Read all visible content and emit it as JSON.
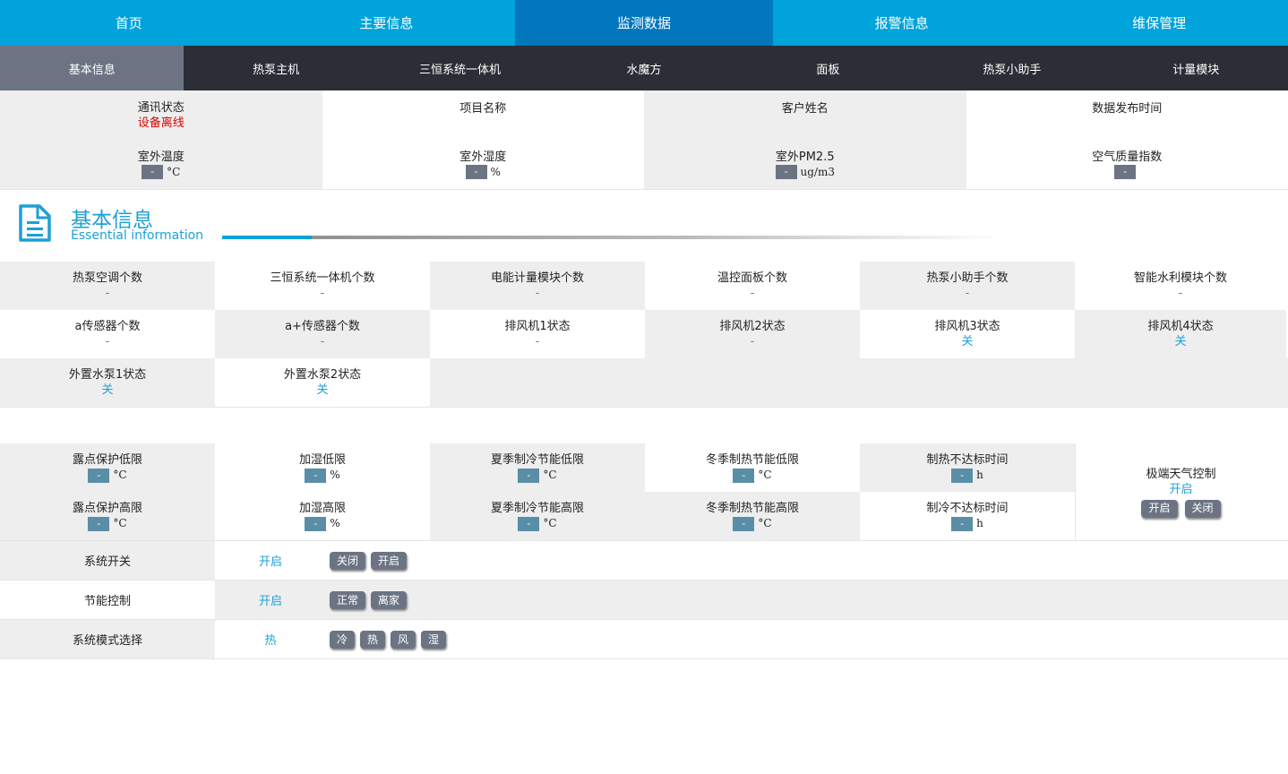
{
  "top_tabs": [
    "首页",
    "主要信息",
    "监测数据",
    "报警信息",
    "维保管理"
  ],
  "sub_tabs": [
    "基本信息",
    "热泵主机",
    "三恒系统一体机",
    "水魔方",
    "面板",
    "热泵小助手",
    "计量模块"
  ],
  "status": {
    "comm_label": "通讯状态",
    "comm_value": "设备离线",
    "project_label": "项目名称",
    "customer_label": "客户姓名",
    "publish_label": "数据发布时间"
  },
  "env": [
    {
      "label": "室外温度",
      "value": "-",
      "unit": "°C"
    },
    {
      "label": "室外湿度",
      "value": "-",
      "unit": "%"
    },
    {
      "label": "室外PM2.5",
      "value": "-",
      "unit": "ug/m3"
    },
    {
      "label": "空气质量指数",
      "value": "-",
      "unit": ""
    }
  ],
  "section": {
    "title": "基本信息",
    "subtitle": "Essential information"
  },
  "counts_row1": [
    {
      "label": "热泵空调个数",
      "value": "-"
    },
    {
      "label": "三恒系统一体机个数",
      "value": "-"
    },
    {
      "label": "电能计量模块个数",
      "value": "-"
    },
    {
      "label": "温控面板个数",
      "value": "-"
    },
    {
      "label": "热泵小助手个数",
      "value": "-"
    },
    {
      "label": "智能水利模块个数",
      "value": "-"
    }
  ],
  "counts_row2": [
    {
      "label": "a传感器个数",
      "value": "-"
    },
    {
      "label": "a+传感器个数",
      "value": "-"
    },
    {
      "label": "排风机1状态",
      "value": "-"
    },
    {
      "label": "排风机2状态",
      "value": "-"
    },
    {
      "label": "排风机3状态",
      "value": "关"
    },
    {
      "label": "排风机4状态",
      "value": "关"
    }
  ],
  "counts_row3": [
    {
      "label": "外置水泵1状态",
      "value": "关"
    },
    {
      "label": "外置水泵2状态",
      "value": "关"
    }
  ],
  "limits_row1": [
    {
      "label": "露点保护低限",
      "value": "-",
      "unit": "°C"
    },
    {
      "label": "加湿低限",
      "value": "-",
      "unit": "%"
    },
    {
      "label": "夏季制冷节能低限",
      "value": "-",
      "unit": "°C"
    },
    {
      "label": "冬季制热节能低限",
      "value": "-",
      "unit": "°C"
    },
    {
      "label": "制热不达标时间",
      "value": "-",
      "unit": "h"
    }
  ],
  "limits_row2": [
    {
      "label": "露点保护高限",
      "value": "-",
      "unit": "°C"
    },
    {
      "label": "加湿高限",
      "value": "-",
      "unit": "%"
    },
    {
      "label": "夏季制冷节能高限",
      "value": "-",
      "unit": "°C"
    },
    {
      "label": "冬季制热节能高限",
      "value": "-",
      "unit": "°C"
    },
    {
      "label": "制冷不达标时间",
      "value": "-",
      "unit": "h"
    }
  ],
  "extreme": {
    "label": "极端天气控制",
    "value": "开启",
    "btn_on": "开启",
    "btn_off": "关闭"
  },
  "controls": [
    {
      "label": "系统开关",
      "value": "开启",
      "buttons": [
        "关闭",
        "开启"
      ]
    },
    {
      "label": "节能控制",
      "value": "开启",
      "buttons": [
        "正常",
        "离家"
      ]
    },
    {
      "label": "系统模式选择",
      "value": "热",
      "buttons": [
        "冷",
        "热",
        "风",
        "湿"
      ]
    }
  ],
  "colors": {
    "accent": "#00a3da",
    "active_tab": "#0277bd",
    "subnav_bg": "#2b2e36",
    "alert": "#e00000"
  }
}
